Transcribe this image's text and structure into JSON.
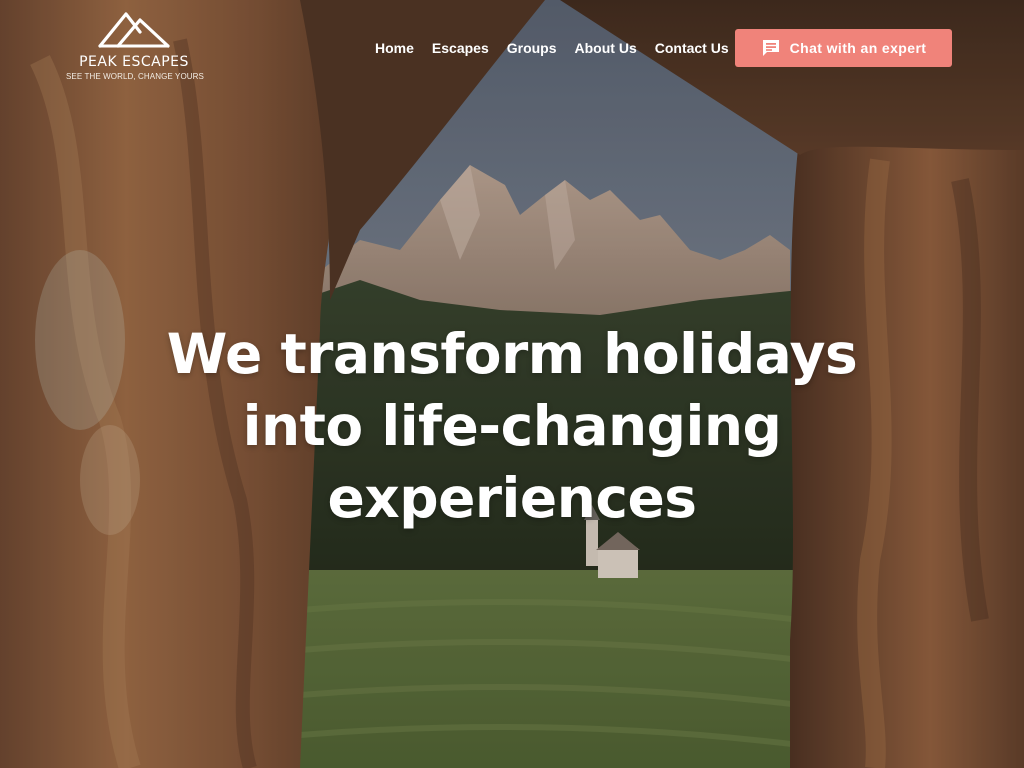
{
  "brand": {
    "name": "PEAK ESCAPES",
    "tagline": "SEE THE WORLD, CHANGE YOURS",
    "logo_icon": "mountain-peaks-logo"
  },
  "nav": {
    "items": [
      {
        "label": "Home"
      },
      {
        "label": "Escapes"
      },
      {
        "label": "Groups"
      },
      {
        "label": "About Us"
      },
      {
        "label": "Contact Us"
      }
    ]
  },
  "cta": {
    "label": "Chat with an expert",
    "icon": "chat-bubble-icon",
    "color": "#f0837a"
  },
  "hero": {
    "headline_lines": [
      "We transform holidays",
      "into life-changing",
      "experiences"
    ]
  }
}
